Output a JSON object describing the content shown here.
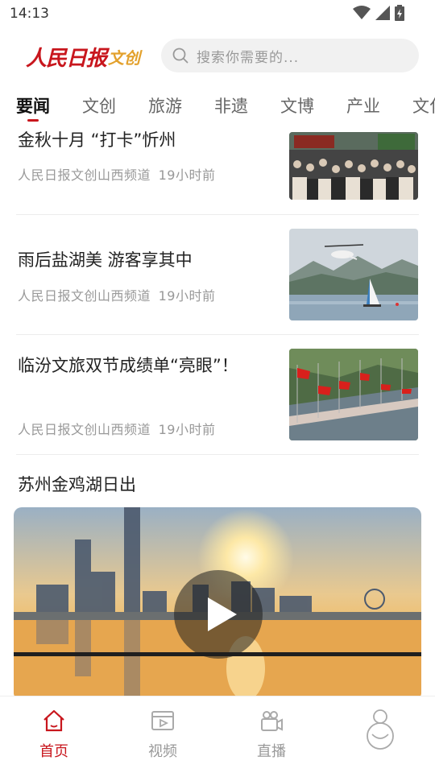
{
  "status_bar": {
    "time": "14:13"
  },
  "header": {
    "logo_main": "人民日报",
    "logo_sub": "文创",
    "search_placeholder": "搜索你需要的..."
  },
  "tabs": [
    "要闻",
    "文创",
    "旅游",
    "非遗",
    "文博",
    "产业",
    "文化"
  ],
  "active_tab": "要闻",
  "news": [
    {
      "title": "金秋十月 “打卡”忻州",
      "source": "人民日报文创山西频道",
      "time": "19小时前",
      "thumb": "crowd-at-scenic-gate"
    },
    {
      "title": "雨后盐湖美 游客享其中",
      "source": "人民日报文创山西频道",
      "time": "19小时前",
      "thumb": "helicopter-over-lake"
    },
    {
      "title": "临汾文旅双节成绩单“亮眼”！",
      "source": "人民日报文创山西频道",
      "time": "19小时前",
      "thumb": "red-flags-on-bridge"
    }
  ],
  "video": {
    "title": "苏州金鸡湖日出"
  },
  "bottom_nav": [
    {
      "label": "首页",
      "icon": "home-icon",
      "active": true
    },
    {
      "label": "视频",
      "icon": "video-icon",
      "active": false
    },
    {
      "label": "直播",
      "icon": "live-camera-icon",
      "active": false
    },
    {
      "label": "",
      "icon": "user-icon",
      "active": false
    }
  ],
  "colors": {
    "brand_red": "#c8161d",
    "logo_gold": "#e3a12d",
    "muted": "#999999"
  }
}
